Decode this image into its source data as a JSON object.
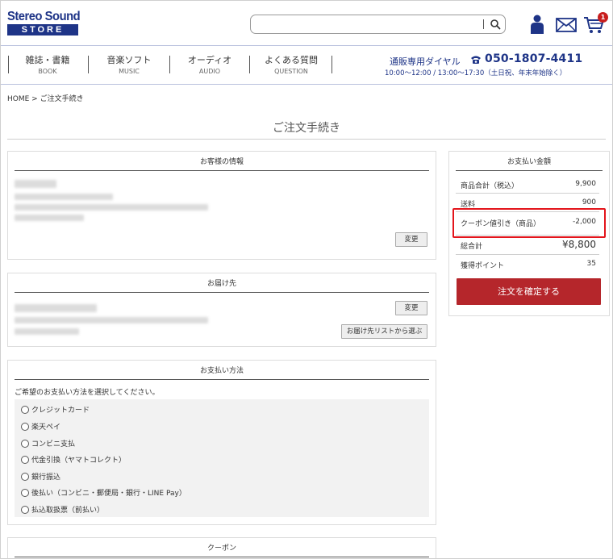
{
  "header": {
    "logo_line1": "Stereo Sound",
    "logo_line2": "STORE",
    "search_placeholder": "",
    "cart_count": "1",
    "icons": [
      "search-icon",
      "user-icon",
      "mail-icon",
      "cart-icon",
      "phone-icon"
    ]
  },
  "nav": {
    "items": [
      {
        "ja": "雑誌・書籍",
        "en": "BOOK"
      },
      {
        "ja": "音楽ソフト",
        "en": "MUSIC"
      },
      {
        "ja": "オーディオ",
        "en": "AUDIO"
      },
      {
        "ja": "よくある質問",
        "en": "QUESTION"
      }
    ],
    "phone_label": "通販専用ダイヤル",
    "phone_number": "050-1807-4411",
    "phone_hours": "10:00～12:00 / 13:00～17:30（土日祝、年末年始除く）"
  },
  "breadcrumb": "HOME > ご注文手続き",
  "page_title": "ご注文手続き",
  "customer": {
    "title": "お客様の情報",
    "change_button": "変更"
  },
  "delivery": {
    "title": "お届け先",
    "change_button": "変更",
    "list_button": "お届け先リストから選ぶ"
  },
  "payment": {
    "title": "お支払い方法",
    "intro": "ご希望のお支払い方法を選択してください。",
    "options": [
      "クレジットカード",
      "楽天ペイ",
      "コンビニ支払",
      "代金引換（ヤマトコレクト）",
      "銀行振込",
      "後払い（コンビニ・郵便局・銀行・LINE Pay）",
      "払込取扱票（前払い）"
    ]
  },
  "coupon": {
    "title": "クーポン"
  },
  "summary": {
    "title": "お支払い金額",
    "subtotal_label": "商品合計（税込）",
    "subtotal_value": "9,900",
    "shipping_label": "送料",
    "shipping_value": "900",
    "coupon_label": "クーポン値引き（商品）",
    "coupon_value": "-2,000",
    "total_label": "総合計",
    "total_value": "¥8,800",
    "points_label": "獲得ポイント",
    "points_value": "35",
    "confirm_button": "注文を確定する",
    "highlight_color": "#e3141b",
    "confirm_color": "#b5262b"
  },
  "colors": {
    "brand": "#1e3487"
  }
}
